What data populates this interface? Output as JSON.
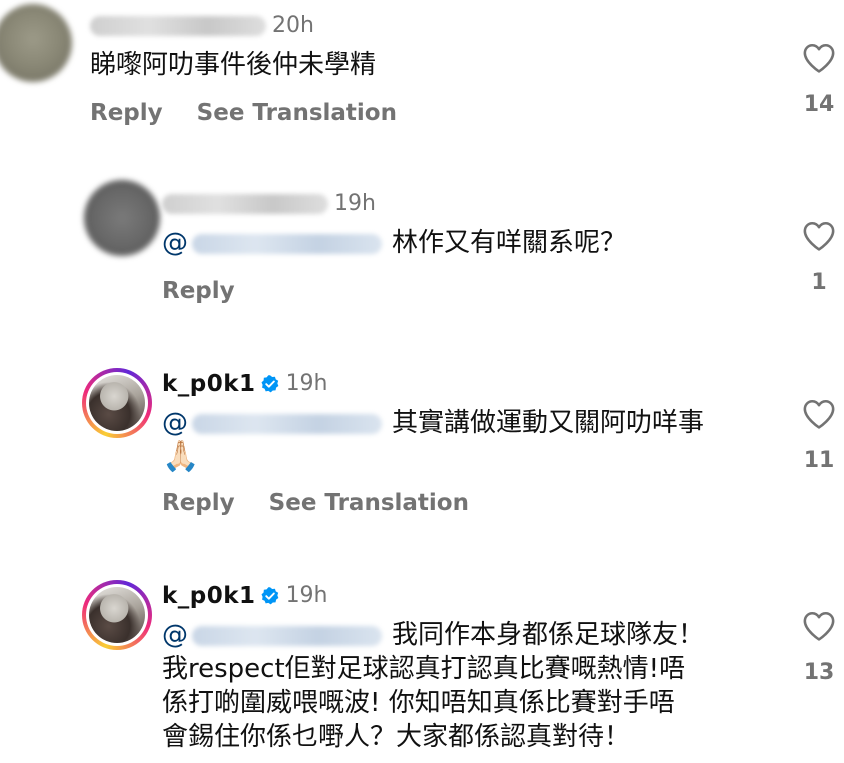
{
  "comments": [
    {
      "time": "20h",
      "text": "睇嚟阿叻事件後仲未學精",
      "reply_label": "Reply",
      "translate_label": "See Translation",
      "likes": "14"
    },
    {
      "time": "19h",
      "mention_prefix": "@",
      "text": "林作又有咩關系呢？",
      "reply_label": "Reply",
      "likes": "1"
    },
    {
      "username": "k_p0k1",
      "time": "19h",
      "mention_prefix": "@",
      "text": "其實講做運動又關阿叻咩事",
      "emoji": "🙏🏻",
      "reply_label": "Reply",
      "translate_label": "See Translation",
      "likes": "11"
    },
    {
      "username": "k_p0k1",
      "time": "19h",
      "mention_prefix": "@",
      "line1": "我同作本身都係足球隊友！",
      "line2": "我respect佢對足球認真打認真比賽嘅熱情!唔",
      "line3": "係打啲圍威喂嘅波! 你知唔知真係比賽對手唔",
      "line4": "會錫住你係乜嘢人？大家都係認真對待！",
      "likes": "13"
    }
  ],
  "colors": {
    "verified": "#0095f6",
    "mention": "#00376b",
    "secondary": "#737373"
  }
}
